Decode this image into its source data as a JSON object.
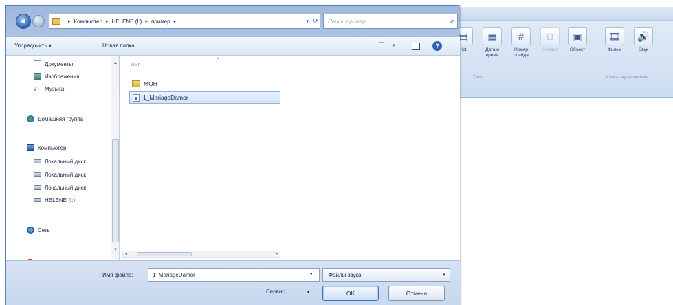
{
  "address_bar": {
    "crumbs": [
      "Компьютер",
      "HELENE (I:)",
      "пример"
    ],
    "search_placeholder": "Поиск: пример"
  },
  "toolbar": {
    "organize_label": "Упорядочить ▾",
    "new_folder_label": "Новая папка"
  },
  "nav_pane": {
    "items": [
      {
        "label": "Документы",
        "icon": "documents-icon"
      },
      {
        "label": "Изображения",
        "icon": "pictures-icon"
      },
      {
        "label": "Музыка",
        "icon": "music-icon"
      },
      {
        "label": "Домашняя группа",
        "icon": "homegroup-icon"
      },
      {
        "label": "Компьютер",
        "icon": "computer-icon"
      },
      {
        "label": "Локальный диск",
        "icon": "drive-icon"
      },
      {
        "label": "Локальный диск",
        "icon": "drive-icon"
      },
      {
        "label": "Локальный диск",
        "icon": "drive-icon"
      },
      {
        "label": "HELENE (I:)",
        "icon": "usb-drive-icon"
      },
      {
        "label": "Сеть",
        "icon": "network-icon"
      }
    ]
  },
  "file_list": {
    "column_header": "Имя",
    "items": [
      {
        "name": "МОНТ",
        "type": "folder",
        "selected": false
      },
      {
        "name": "1_MariageDamor",
        "type": "sound-file",
        "selected": true
      }
    ]
  },
  "bottom": {
    "filename_label": "Имя файла:",
    "filename_value": "1_MariageDamor",
    "filetype_value": "Файлы звука",
    "service_label": "Сервис",
    "ok_label": "OK",
    "cancel_label": "Отмена"
  },
  "ribbon": {
    "buttons": [
      {
        "label": "ript",
        "dim": false
      },
      {
        "label": "Дата и время",
        "dim": false
      },
      {
        "label": "Номер слайда",
        "dim": false
      },
      {
        "label": "Символ",
        "dim": true
      },
      {
        "label": "Объект",
        "dim": false
      },
      {
        "label": "Фильм",
        "dim": false
      },
      {
        "label": "Звук",
        "dim": false
      }
    ],
    "group_text_label": "Текст",
    "group_media_label": "Клипы мультимедиа"
  }
}
